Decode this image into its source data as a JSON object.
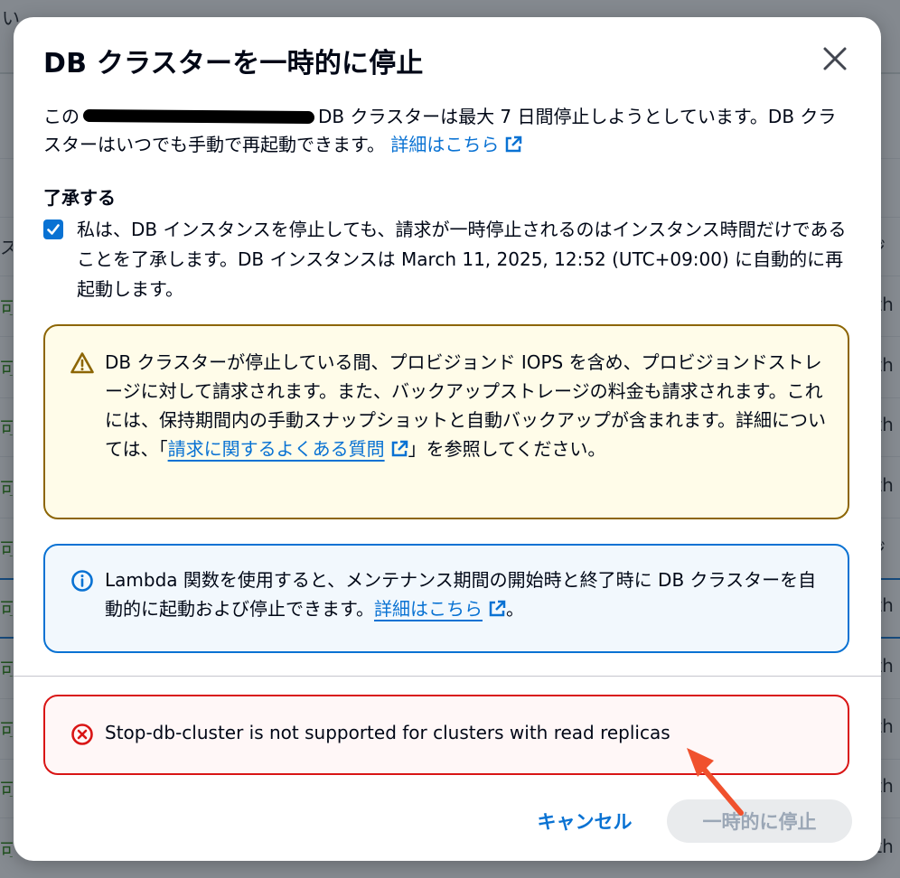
{
  "modal": {
    "title": "DB クラスターを一時的に停止",
    "body": {
      "prefix": "この",
      "suffix": "DB クラスターは最大 7 日間停止しようとしています。DB クラスターはいつでも手動で再起動できます。",
      "link": "詳細はこちら"
    },
    "acknowledge": {
      "title": "了承する",
      "checked": true,
      "text": "私は、DB インスタンスを停止しても、請求が一時停止されるのはインスタンス時間だけであることを了承します。DB インスタンスは March 11, 2025, 12:52 (UTC+09:00) に自動的に再起動します。"
    },
    "warning_alert": {
      "text_before": "DB クラスターが停止している間、プロビジョンド IOPS を含め、プロビジョンドストレージに対して請求されます。また、バックアップストレージの料金も請求されます。これには、保持期間内の手動スナップショットと自動バックアップが含まれます。詳細については、「",
      "link": "請求に関するよくある質問",
      "text_after": "」を参照してください。"
    },
    "info_alert": {
      "text_before": "Lambda 関数を使用すると、メンテナンス期間の開始時と終了時に DB クラスターを自動的に起動および停止できます。",
      "link": "詳細はこちら",
      "text_after": "。"
    },
    "error_alert": {
      "text": "Stop-db-cluster is not supported for clusters with read replicas"
    },
    "buttons": {
      "cancel": "キャンセル",
      "confirm": "一時的に停止"
    }
  },
  "background": {
    "top_fragment": "い",
    "left_column": [
      "ス",
      "可能",
      "可能",
      "可能",
      "可能",
      "可能",
      "可能",
      "可能",
      "可能",
      "可能",
      "可能"
    ],
    "right_column": [
      "ジ",
      "rth",
      "rth",
      "rth",
      "rth",
      "ジ",
      "rth",
      "rth",
      "rth",
      "rth",
      "rth"
    ]
  },
  "colors": {
    "link": "#0972d3",
    "warning_border": "#8d6605",
    "info_border": "#0972d3",
    "error_border": "#d91515",
    "arrow": "#f0512d"
  },
  "icons": {
    "close": "close-icon",
    "external": "external-link-icon",
    "warning": "warning-triangle-icon",
    "info": "info-circle-icon",
    "error": "error-circle-x-icon",
    "checkbox": "checkmark-icon"
  }
}
